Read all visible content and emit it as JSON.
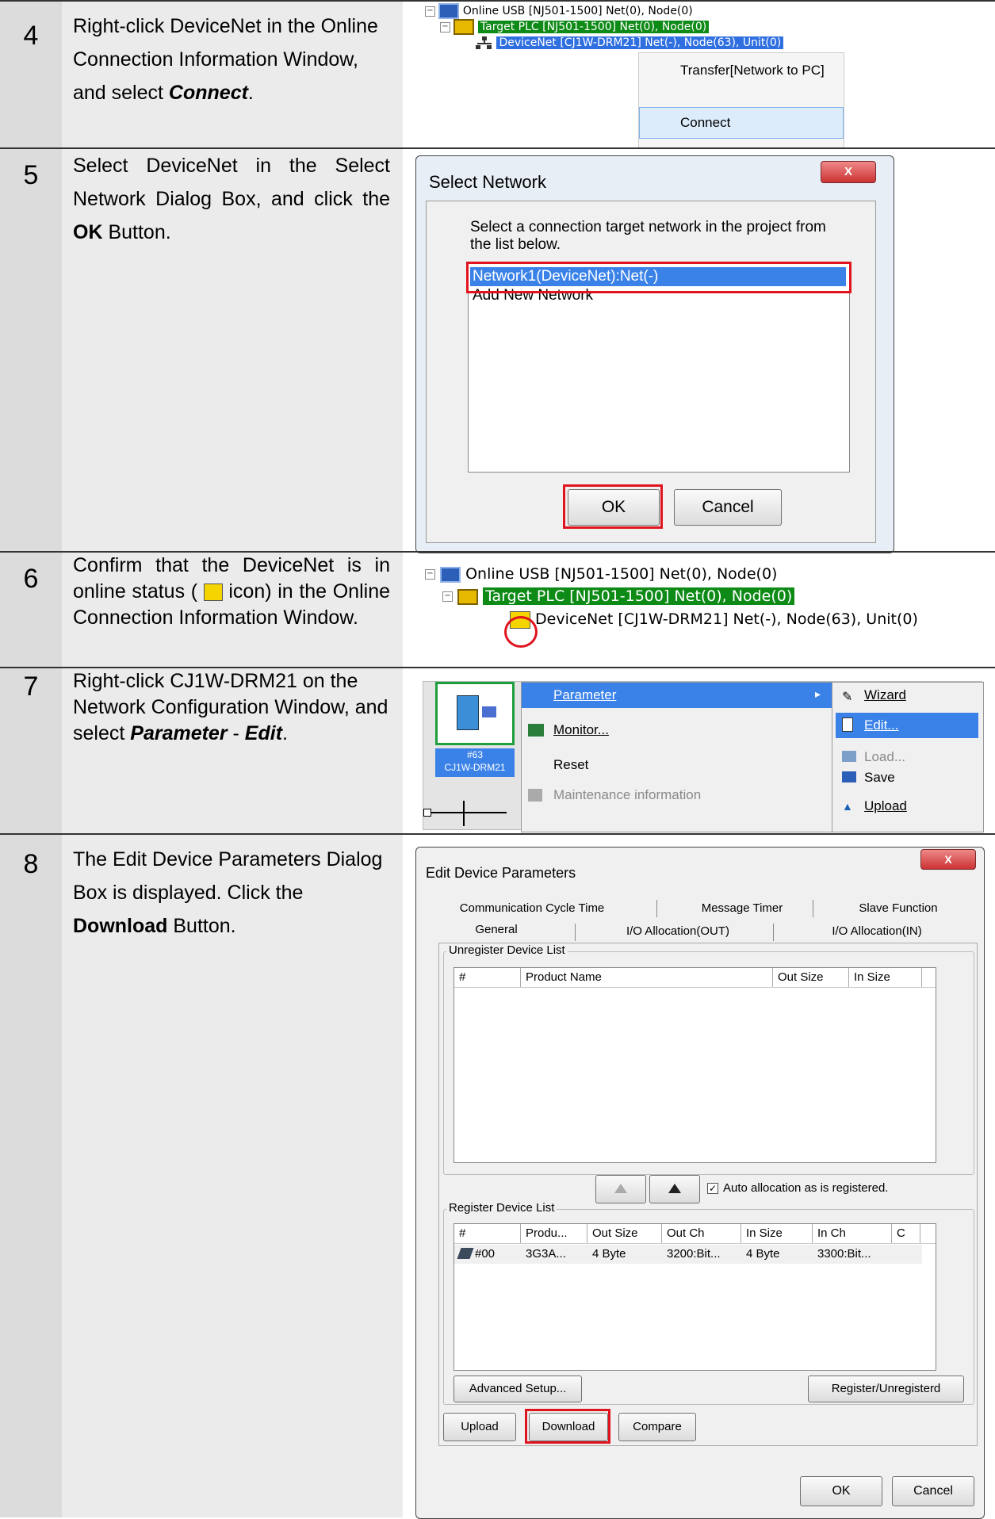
{
  "steps": [
    {
      "number": "4",
      "text_parts": [
        "Right-click DeviceNet in the Online Connection Information Window, and select ",
        "Connect",
        "."
      ],
      "tree": {
        "root": "Online USB  [NJ501-1500] Net(0), Node(0)",
        "plc": "Target PLC [NJ501-1500] Net(0), Node(0)",
        "device": "DeviceNet [CJ1W-DRM21] Net(-), Node(63), Unit(0)"
      },
      "context_menu": [
        "Transfer[Network to PC]",
        "Connect"
      ]
    },
    {
      "number": "5",
      "text_parts": [
        "Select DeviceNet in the Select Network Dialog Box, and click the ",
        "OK",
        " Button."
      ],
      "dialog": {
        "title": "Select Network",
        "close": "X",
        "instruction": "Select a connection target network in the project from the list below.",
        "items": [
          "Network1(DeviceNet):Net(-)",
          "Add New Network"
        ],
        "ok": "OK",
        "cancel": "Cancel"
      }
    },
    {
      "number": "6",
      "text_parts": [
        "Confirm that the DeviceNet is in online status ( ",
        " icon) in the Online Connection Information Window."
      ],
      "tree": {
        "root": "Online USB  [NJ501-1500] Net(0), Node(0)",
        "plc": "Target PLC [NJ501-1500] Net(0), Node(0)",
        "device": "DeviceNet [CJ1W-DRM21] Net(-), Node(63), Unit(0)"
      }
    },
    {
      "number": "7",
      "text_parts": [
        "Right-click CJ1W-DRM21 on the Network Configuration Window, and select ",
        "Parameter",
        " - ",
        "Edit",
        "."
      ],
      "device_label": [
        "#63",
        "CJ1W-DRM21"
      ],
      "menu": [
        "Parameter",
        "Monitor...",
        "Reset",
        "Maintenance information"
      ],
      "submenu": [
        "Wizard",
        "Edit...",
        "Load...",
        "Save",
        "Upload"
      ]
    },
    {
      "number": "8",
      "text_parts": [
        "The Edit Device Parameters Dialog Box is displayed. Click the ",
        "Download",
        " Button."
      ],
      "dialog": {
        "title": "Edit Device Parameters",
        "close": "X",
        "tabs_back": [
          "Communication Cycle Time",
          "Message Timer",
          "Slave Function"
        ],
        "tabs_front": [
          "General",
          "I/O Allocation(OUT)",
          "I/O Allocation(IN)"
        ],
        "unregister_title": "Unregister Device List",
        "unregister_cols": [
          "#",
          "Product Name",
          "Out Size",
          "In Size"
        ],
        "auto_alloc": "Auto allocation as is registered.",
        "register_title": "Register Device List",
        "register_cols": [
          "#",
          "Produ...",
          "Out Size",
          "Out Ch",
          "In Size",
          "In Ch",
          "C"
        ],
        "register_row": [
          "#00",
          "3G3A...",
          "4 Byte",
          "3200:Bit...",
          "4 Byte",
          "3300:Bit..."
        ],
        "advanced": "Advanced Setup...",
        "register_btn": "Register/Unregisterd",
        "upload": "Upload",
        "download": "Download",
        "compare": "Compare",
        "ok": "OK",
        "cancel": "Cancel"
      }
    }
  ],
  "colors": {
    "highlight_green": "#0e8a16",
    "highlight_blue": "#2f6fe0",
    "red_outline": "#e0141e",
    "number_cell": "#dcdcdc",
    "text_cell": "#ebebeb"
  }
}
